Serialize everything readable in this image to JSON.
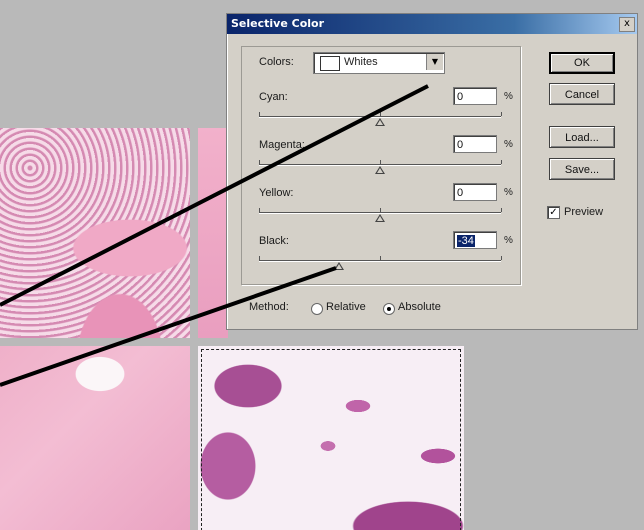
{
  "dialog": {
    "title": "Selective Color",
    "close_glyph": "x",
    "colors_label": "Colors:",
    "colors_value": "Whites",
    "dropdown_arrow": "▼",
    "sliders": [
      {
        "label": "Cyan:",
        "value": "0",
        "unit": "%",
        "level": 0
      },
      {
        "label": "Magenta:",
        "value": "0",
        "unit": "%",
        "level": 0
      },
      {
        "label": "Yellow:",
        "value": "0",
        "unit": "%",
        "level": 0
      },
      {
        "label": "Black:",
        "value": "-34",
        "unit": "%",
        "level": -34
      }
    ],
    "buttons": {
      "ok": "OK",
      "cancel": "Cancel",
      "load": "Load...",
      "save": "Save..."
    },
    "preview": {
      "label": "Preview",
      "checked": true,
      "check_glyph": "✓"
    },
    "method": {
      "label": "Method:",
      "relative": "Relative",
      "absolute": "Absolute",
      "selected": "absolute"
    }
  },
  "colors": {
    "title_bar": "#0a246a",
    "dialog_bg": "#d4d0c8",
    "workspace": "#b9b9b9",
    "callout_line": "#000000"
  },
  "icons": [
    "close-icon",
    "dropdown-arrow-icon",
    "slider-thumb-icon",
    "checkbox-icon",
    "radio-icon"
  ]
}
